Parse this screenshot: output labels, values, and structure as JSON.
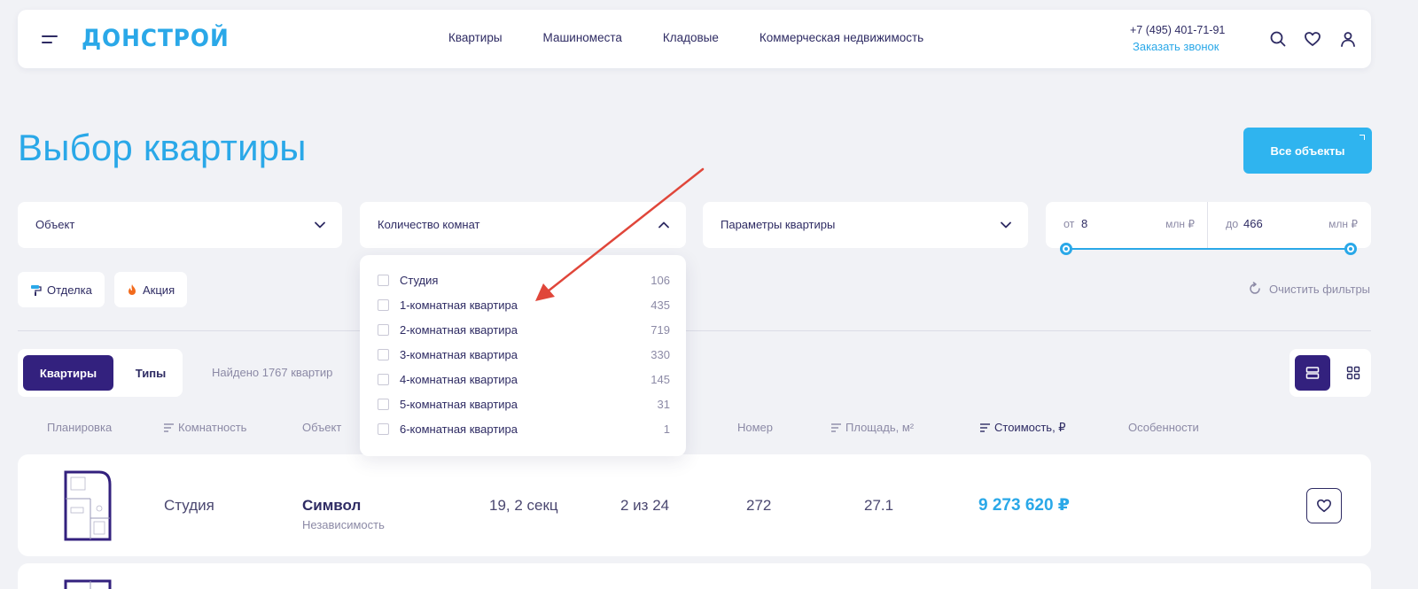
{
  "header": {
    "logo": "ДОНСТРОЙ",
    "nav": [
      "Квартиры",
      "Машиноместа",
      "Кладовые",
      "Коммерческая недвижимость"
    ],
    "phone": "+7 (495) 401-71-91",
    "callback": "Заказать звонок",
    "icons": [
      "menu-icon",
      "search-icon",
      "heart-icon",
      "user-icon"
    ]
  },
  "page": {
    "title": "Выбор квартиры",
    "all_objects": "Все объекты"
  },
  "filters": {
    "object": "Объект",
    "rooms": "Количество комнат",
    "params": "Параметры квартиры",
    "price_from_prefix": "от",
    "price_from": "8",
    "price_to_prefix": "до",
    "price_to": "466",
    "price_unit": "млн ₽"
  },
  "tags": {
    "finish": "Отделка",
    "promo": "Акция",
    "clear": "Очистить фильтры"
  },
  "rooms_dropdown": [
    {
      "label": "Студия",
      "count": "106"
    },
    {
      "label": "1-комнатная квартира",
      "count": "435"
    },
    {
      "label": "2-комнатная квартира",
      "count": "719"
    },
    {
      "label": "3-комнатная квартира",
      "count": "330"
    },
    {
      "label": "4-комнатная квартира",
      "count": "145"
    },
    {
      "label": "5-комнатная квартира",
      "count": "31"
    },
    {
      "label": "6-комнатная квартира",
      "count": "1"
    }
  ],
  "results": {
    "tab_apartments": "Квартиры",
    "tab_types": "Типы",
    "found": "Найдено 1767 квартир"
  },
  "table_headers": {
    "plan": "Планировка",
    "rooms": "Комнатность",
    "object": "Объект",
    "number": "Номер",
    "area": "Площадь, м²",
    "price": "Стоимость, ₽",
    "features": "Особенности"
  },
  "rows": [
    {
      "type": "Студия",
      "object": "Символ",
      "district": "Независимость",
      "building": "19, 2 секц",
      "floor": "2 из 24",
      "number": "272",
      "area": "27.1",
      "price": "9 273 620 ₽"
    }
  ],
  "colors": {
    "accent": "#2aa8e8",
    "primary": "#33217e",
    "background": "#f1f2f6",
    "annotation_arrow": "#e0463a"
  }
}
